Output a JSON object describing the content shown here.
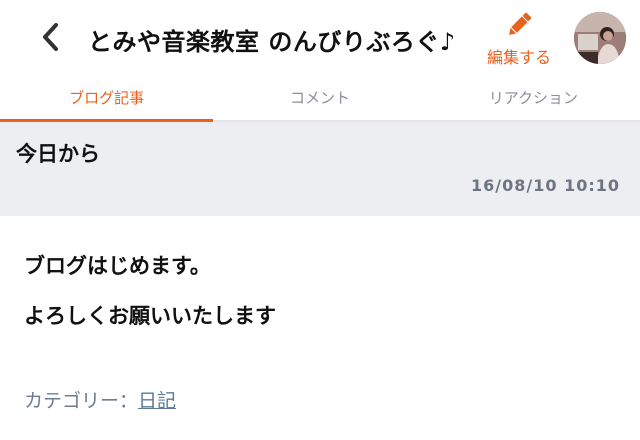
{
  "header": {
    "back_icon": "chevron-left-icon",
    "title": "とみや音楽教室 のんびりぶろぐ♪",
    "edit_icon": "pencil-icon",
    "edit_label": "編集する",
    "accent": "#e8621e"
  },
  "tabs": [
    {
      "label": "ブログ記事",
      "active": true
    },
    {
      "label": "コメント",
      "active": false
    },
    {
      "label": "リアクション",
      "active": false
    }
  ],
  "post": {
    "title": "今日から",
    "date": "16/08/10 10:10",
    "body": [
      "ブログはじめます。",
      "よろしくお願いいたします"
    ],
    "category_label": "カテゴリー：",
    "category_value": "日記"
  }
}
